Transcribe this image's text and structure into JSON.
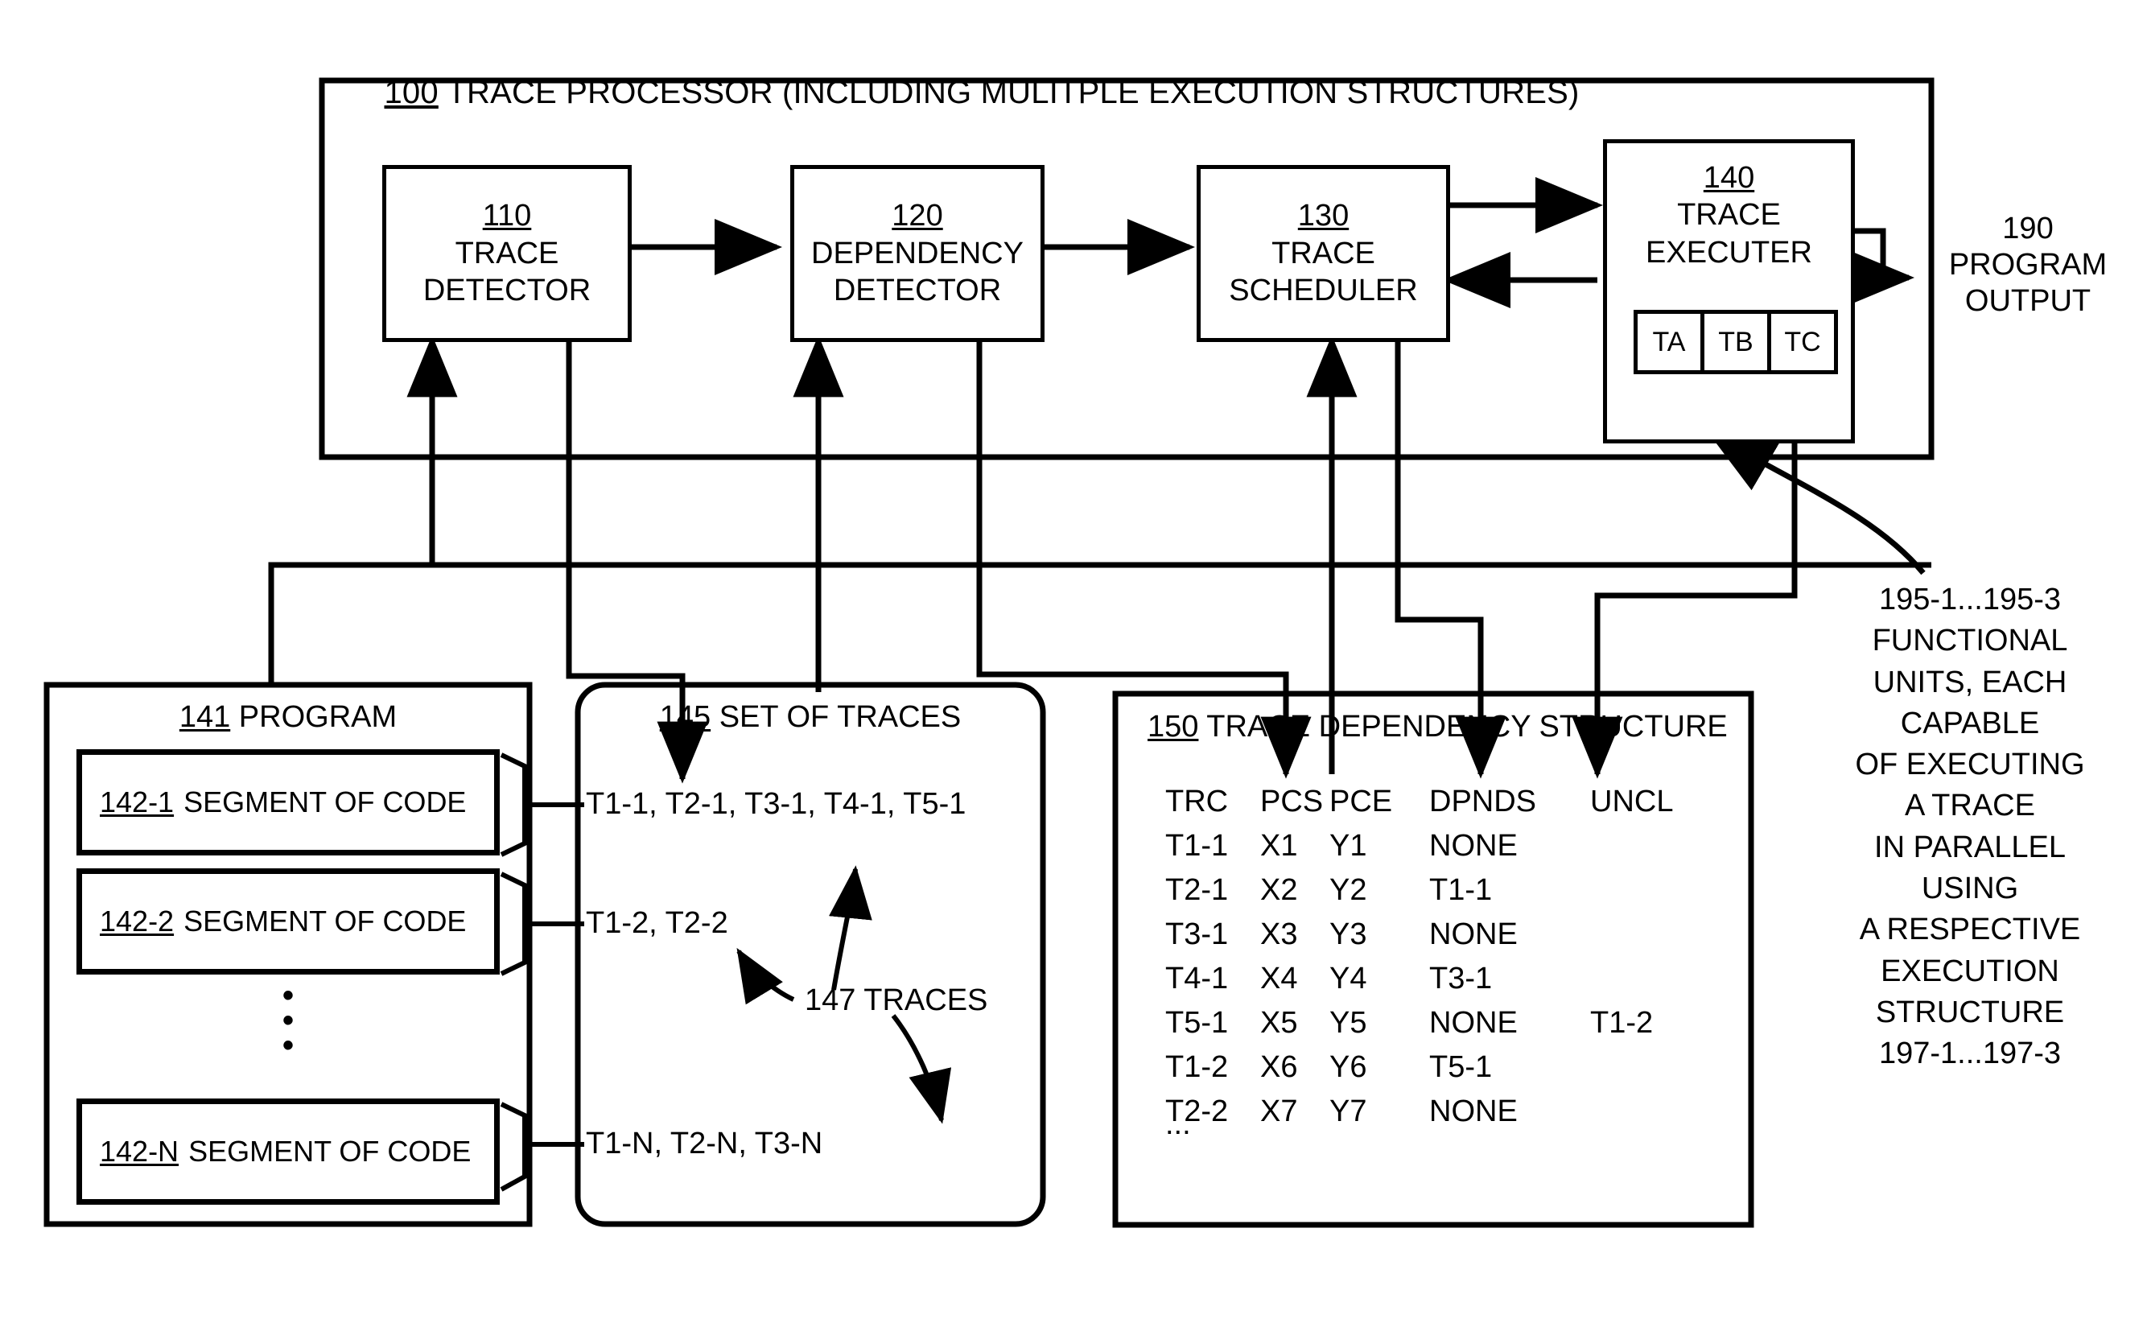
{
  "figure": {
    "processor": {
      "id": "100",
      "title": "TRACE PROCESSOR (INCLUDING MULITPLE EXECUTION STRUCTURES)"
    },
    "units": [
      {
        "id": "110",
        "line1": "TRACE",
        "line2": "DETECTOR"
      },
      {
        "id": "120",
        "line1": "DEPENDENCY",
        "line2": "DETECTOR"
      },
      {
        "id": "130",
        "line1": "TRACE",
        "line2": "SCHEDULER"
      },
      {
        "id": "140",
        "line1": "TRACE",
        "line2": "EXECUTER"
      }
    ],
    "executer_cells": [
      "TA",
      "TB",
      "TC"
    ],
    "program_output": {
      "id": "190",
      "line1": "PROGRAM",
      "line2": "OUTPUT"
    },
    "program_panel": {
      "id": "141",
      "title": "PROGRAM",
      "segments": [
        {
          "id": "142-1",
          "label": "SEGMENT OF CODE"
        },
        {
          "id": "142-2",
          "label": "SEGMENT OF CODE"
        },
        {
          "id": "142-N",
          "label": "SEGMENT OF CODE"
        }
      ],
      "vertical_ellipsis": "•"
    },
    "traces_panel": {
      "id": "145",
      "title": "SET OF TRACES",
      "rows": [
        "T1-1, T2-1, T3-1, T4-1, T5-1",
        "T1-2, T2-2",
        "T1-N, T2-N, T3-N"
      ],
      "callout": "147 TRACES"
    },
    "dependency_panel": {
      "id": "150",
      "title": "TRACE DEPENDENCY STRUCTURE",
      "columns": [
        "TRC",
        "PCS",
        "PCE",
        "DPNDS",
        "UNCL"
      ],
      "rows": [
        [
          "T1-1",
          "X1",
          "Y1",
          "NONE",
          ""
        ],
        [
          "T2-1",
          "X2",
          "Y2",
          "T1-1",
          ""
        ],
        [
          "T3-1",
          "X3",
          "Y3",
          "NONE",
          ""
        ],
        [
          "T4-1",
          "X4",
          "Y4",
          "T3-1",
          ""
        ],
        [
          "T5-1",
          "X5",
          "Y5",
          "NONE",
          "T1-2"
        ],
        [
          "T1-2",
          "X6",
          "Y6",
          "T5-1",
          ""
        ],
        [
          "T2-2",
          "X7",
          "Y7",
          "NONE",
          ""
        ]
      ],
      "ellipsis": "..."
    },
    "functional_units_note": [
      "195-1...195-3",
      "FUNCTIONAL",
      "UNITS, EACH",
      "CAPABLE",
      "OF EXECUTING",
      "A TRACE",
      "IN PARALLEL",
      "USING",
      "A RESPECTIVE",
      "EXECUTION",
      "STRUCTURE",
      "197-1...197-3"
    ]
  },
  "colors": {
    "ink": "#000000",
    "paper": "#ffffff"
  }
}
